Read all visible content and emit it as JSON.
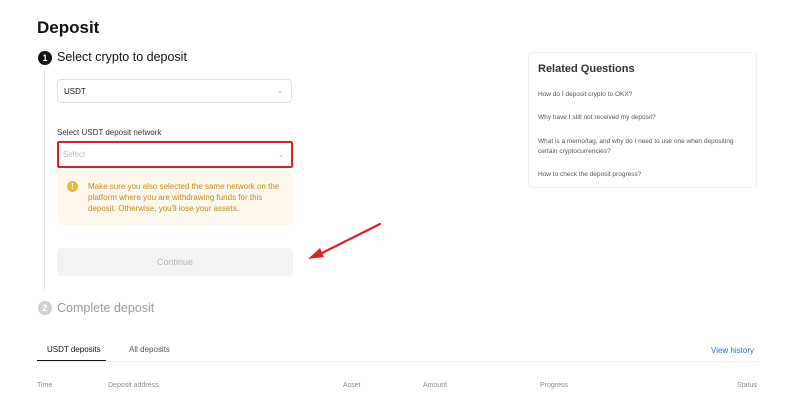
{
  "page": {
    "title": "Deposit"
  },
  "colors": {
    "accent": "#121212",
    "highlight_border": "#e01f26",
    "warning": "#f3b52a",
    "link": "#2b6de3",
    "arrow": "#e01f26"
  },
  "steps": [
    {
      "number": "1",
      "label": "Select crypto to deposit"
    },
    {
      "number": "2",
      "label": "Complete deposit"
    }
  ],
  "coin_select": {
    "value": "USDT",
    "icon": "chevron-down-icon"
  },
  "network": {
    "label": "Select USDT deposit network",
    "placeholder": "Select",
    "icon": "chevron-down-icon"
  },
  "warning": {
    "icon": "!",
    "text": "Make sure you also selected the same network on the platform where you are withdrawing funds for this deposit. Otherwise, you'll lose your assets."
  },
  "continue_button": {
    "label": "Continue"
  },
  "related": {
    "title": "Related Questions",
    "items": [
      "How do I deposit crypto to OKX?",
      "Why have I still not received my deposit?",
      "What is a memo/tag, and why do I need to use one when depositing certain cryptocurrencies?",
      "How to check the deposit progress?"
    ]
  },
  "history": {
    "tabs": [
      "USDT deposits",
      "All deposits"
    ],
    "view_history": "View history",
    "columns": [
      "Time",
      "Deposit address",
      "Asset",
      "Amount",
      "Progress",
      "Status"
    ]
  }
}
